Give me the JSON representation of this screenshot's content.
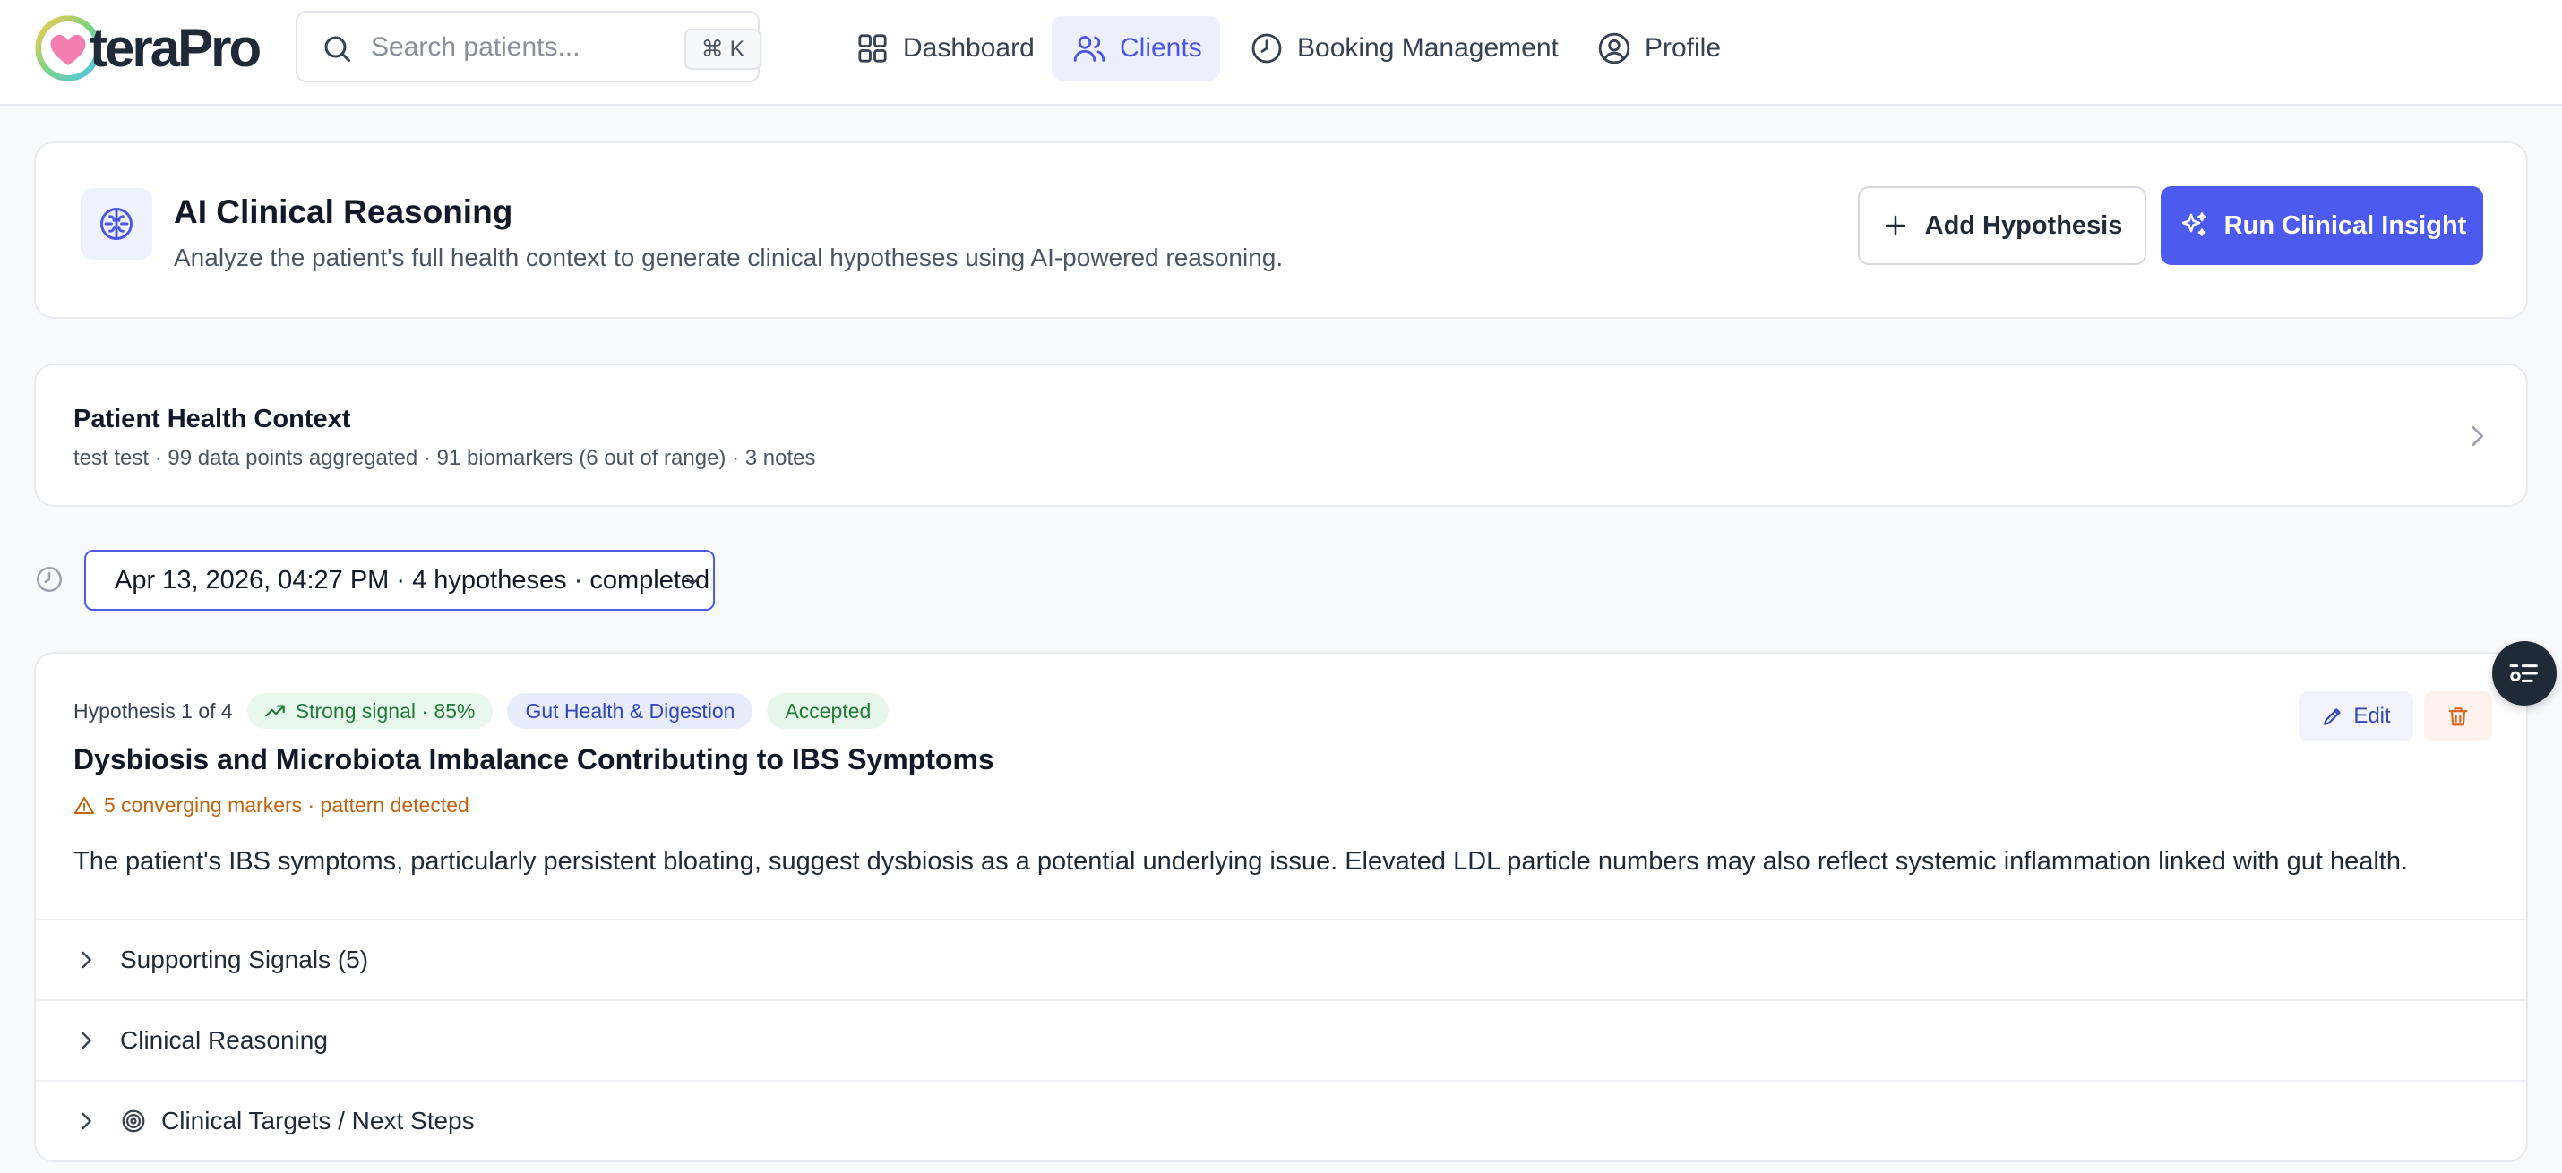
{
  "app": {
    "logo_text": "teraPro"
  },
  "search": {
    "placeholder": "Search patients...",
    "shortcut": "⌘ K"
  },
  "nav": {
    "items": [
      {
        "label": "Dashboard",
        "icon": "grid-icon"
      },
      {
        "label": "Clients",
        "icon": "users-icon",
        "active": true
      },
      {
        "label": "Booking Management",
        "icon": "clock-icon"
      },
      {
        "label": "Profile",
        "icon": "user-circle-icon"
      }
    ]
  },
  "ai_reasoning": {
    "title": "AI Clinical Reasoning",
    "subtitle": "Analyze the patient's full health context to generate clinical hypotheses using AI-powered reasoning.",
    "add_button": "Add Hypothesis",
    "run_button": "Run Clinical Insight"
  },
  "health_context": {
    "title": "Patient Health Context",
    "summary": "test test · 99 data points aggregated · 91 biomarkers (6 out of range) · 3 notes"
  },
  "history": {
    "selected": "Apr 13, 2026, 04:27 PM · 4 hypotheses · completed"
  },
  "hypothesis": {
    "counter": "Hypothesis 1 of 4",
    "signal": "Strong signal · 85%",
    "category": "Gut Health & Digestion",
    "status": "Accepted",
    "edit_label": "Edit",
    "title": "Dysbiosis and Microbiota Imbalance Contributing to IBS Symptoms",
    "warning": "5 converging markers · pattern detected",
    "description": "The patient's IBS symptoms, particularly persistent bloating, suggest dysbiosis as a potential underlying issue. Elevated LDL particle numbers may also reflect systemic inflammation linked with gut health.",
    "sections": [
      {
        "label": "Supporting Signals (5)"
      },
      {
        "label": "Clinical Reasoning"
      },
      {
        "label": "Clinical Targets / Next Steps",
        "icon": "target-icon"
      }
    ]
  },
  "colors": {
    "accent": "#4d5af0",
    "active_nav_bg": "#eceffe",
    "signal_green": "#1f7a3a",
    "warning_orange": "#c2620a"
  }
}
